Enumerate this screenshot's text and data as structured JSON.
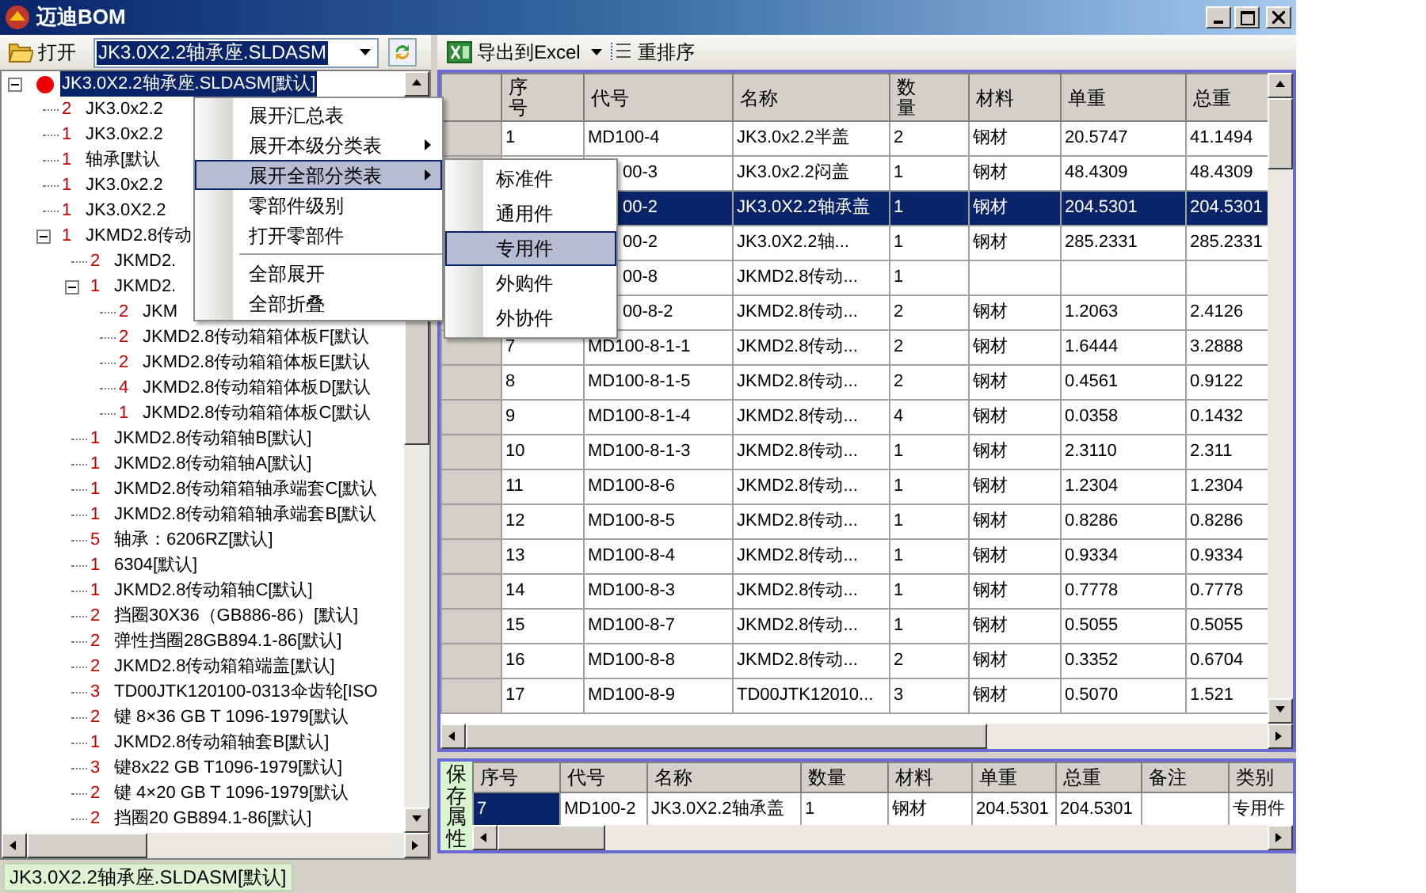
{
  "window": {
    "title": "迈迪BOM"
  },
  "left_toolbar": {
    "open_button": "打开",
    "file_combo": {
      "value": "JK3.0X2.2轴承座.SLDASM"
    }
  },
  "tree": {
    "items": [
      {
        "label": "JK3.0X2.2轴承座.SLDASM[默认]",
        "selected": true,
        "expanded": true,
        "children": [
          {
            "qty": "2",
            "label": "JK3.0x2.2",
            "selected": false
          },
          {
            "qty": "1",
            "label": "JK3.0x2.2",
            "selected": false
          },
          {
            "qty": "1",
            "label": "轴承[默认",
            "selected": false
          },
          {
            "qty": "1",
            "label": "JK3.0x2.2",
            "selected": false
          },
          {
            "qty": "1",
            "label": "JK3.0X2.2",
            "selected": false
          },
          {
            "qty": "1",
            "label": "JKMD2.8传动",
            "selected": false,
            "expanded": true,
            "children": [
              {
                "qty": "2",
                "label": "JKMD2.",
                "selected": false
              },
              {
                "qty": "1",
                "label": "JKMD2.",
                "selected": false,
                "expanded": true,
                "children": [
                  {
                    "qty": "2",
                    "label": "JKM",
                    "selected": false
                  },
                  {
                    "qty": "2",
                    "label": "JKMD2.8传动箱箱体板F[默认",
                    "selected": false
                  },
                  {
                    "qty": "2",
                    "label": "JKMD2.8传动箱箱体板E[默认",
                    "selected": false
                  },
                  {
                    "qty": "4",
                    "label": "JKMD2.8传动箱箱体板D[默认",
                    "selected": false
                  },
                  {
                    "qty": "1",
                    "label": "JKMD2.8传动箱箱体板C[默认",
                    "selected": false
                  }
                ]
              },
              {
                "qty": "1",
                "label": "JKMD2.8传动箱轴B[默认]",
                "selected": false
              },
              {
                "qty": "1",
                "label": "JKMD2.8传动箱轴A[默认]",
                "selected": false
              },
              {
                "qty": "1",
                "label": "JKMD2.8传动箱箱轴承端套C[默认",
                "selected": false
              },
              {
                "qty": "1",
                "label": "JKMD2.8传动箱箱轴承端套B[默认",
                "selected": false
              },
              {
                "qty": "5",
                "label": "轴承：6206RZ[默认]",
                "selected": false
              },
              {
                "qty": "1",
                "label": "6304[默认]",
                "selected": false
              },
              {
                "qty": "1",
                "label": "JKMD2.8传动箱轴C[默认]",
                "selected": false
              },
              {
                "qty": "2",
                "label": "挡圈30X36（GB886-86）[默认]",
                "selected": false
              },
              {
                "qty": "2",
                "label": "弹性挡圈28GB894.1-86[默认]",
                "selected": false
              },
              {
                "qty": "2",
                "label": "JKMD2.8传动箱箱端盖[默认]",
                "selected": false
              },
              {
                "qty": "3",
                "label": "TD00JTK120100-0313伞齿轮[ISO",
                "selected": false
              },
              {
                "qty": "2",
                "label": "键 8×36 GB T 1096-1979[默认",
                "selected": false
              },
              {
                "qty": "1",
                "label": "JKMD2.8传动箱轴套B[默认]",
                "selected": false
              },
              {
                "qty": "3",
                "label": "键8x22 GB T1096-1979[默认]",
                "selected": false
              },
              {
                "qty": "2",
                "label": "键 4×20 GB T 1096-1979[默认",
                "selected": false
              },
              {
                "qty": "2",
                "label": "挡圈20 GB894.1-86[默认]",
                "selected": false
              }
            ]
          }
        ]
      }
    ]
  },
  "context_menu": {
    "items": [
      {
        "kind": "item",
        "label": "展开汇总表",
        "submenu": false,
        "selected": false
      },
      {
        "kind": "item",
        "label": "展开本级分类表",
        "submenu": true,
        "selected": false
      },
      {
        "kind": "item",
        "label": "展开全部分类表",
        "submenu": true,
        "selected": true
      },
      {
        "kind": "item",
        "label": "零部件级别",
        "submenu": false,
        "selected": false
      },
      {
        "kind": "item",
        "label": "打开零部件",
        "submenu": false,
        "selected": false
      },
      {
        "kind": "separator"
      },
      {
        "kind": "item",
        "label": "全部展开",
        "submenu": false,
        "selected": false
      },
      {
        "kind": "item",
        "label": "全部折叠",
        "submenu": false,
        "selected": false
      }
    ]
  },
  "submenu": {
    "items": [
      {
        "label": "标准件",
        "selected": false
      },
      {
        "label": "通用件",
        "selected": false
      },
      {
        "label": "专用件",
        "selected": true
      },
      {
        "label": "外购件",
        "selected": false
      },
      {
        "label": "外协件",
        "selected": false
      }
    ]
  },
  "right_toolbar": {
    "export_button": "导出到Excel",
    "reorder_button": "重排序"
  },
  "grid": {
    "columns": [
      {
        "label": "序号",
        "kind": "stacked"
      },
      {
        "label": "代号",
        "kind": "plain"
      },
      {
        "label": "名称",
        "kind": "plain"
      },
      {
        "label": "数量",
        "kind": "stacked"
      },
      {
        "label": "材料",
        "kind": "plain"
      },
      {
        "label": "单重",
        "kind": "plain"
      },
      {
        "label": "总重",
        "kind": "plain"
      }
    ],
    "rows": [
      {
        "no": "1",
        "code": "MD100-4",
        "name": "JK3.0x2.2半盖",
        "qty": "2",
        "material": "钢材",
        "unit_weight": "20.5747",
        "total_weight": "41.1494",
        "selected": false
      },
      {
        "code": "00-3",
        "name": "JK3.0x2.2闷盖",
        "qty": "1",
        "material": "钢材",
        "unit_weight": "48.4309",
        "total_weight": "48.4309",
        "selected": false
      },
      {
        "code": "00-2",
        "name": "JK3.0X2.2轴承盖",
        "qty": "1",
        "material": "钢材",
        "unit_weight": "204.5301",
        "total_weight": "204.5301",
        "selected": true
      },
      {
        "code": "00-2",
        "name": "JK3.0X2.2轴...",
        "qty": "1",
        "material": "钢材",
        "unit_weight": "285.2331",
        "total_weight": "285.2331",
        "selected": false
      },
      {
        "code": "00-8",
        "name": "JKMD2.8传动...",
        "qty": "1",
        "selected": false
      },
      {
        "code": "00-8-2",
        "name": "JKMD2.8传动...",
        "qty": "2",
        "material": "钢材",
        "unit_weight": "1.2063",
        "total_weight": "2.4126",
        "selected": false
      },
      {
        "no": "7",
        "code": "MD100-8-1-1",
        "name": "JKMD2.8传动...",
        "qty": "2",
        "material": "钢材",
        "unit_weight": "1.6444",
        "total_weight": "3.2888",
        "selected": false
      },
      {
        "no": "8",
        "code": "MD100-8-1-5",
        "name": "JKMD2.8传动...",
        "qty": "2",
        "material": "钢材",
        "unit_weight": "0.4561",
        "total_weight": "0.9122",
        "selected": false
      },
      {
        "no": "9",
        "code": "MD100-8-1-4",
        "name": "JKMD2.8传动...",
        "qty": "4",
        "material": "钢材",
        "unit_weight": "0.0358",
        "total_weight": "0.1432",
        "selected": false
      },
      {
        "no": "10",
        "code": "MD100-8-1-3",
        "name": "JKMD2.8传动...",
        "qty": "1",
        "material": "钢材",
        "unit_weight": "2.3110",
        "total_weight": "2.311",
        "selected": false
      },
      {
        "no": "11",
        "code": "MD100-8-6",
        "name": "JKMD2.8传动...",
        "qty": "1",
        "material": "钢材",
        "unit_weight": "1.2304",
        "total_weight": "1.2304",
        "selected": false
      },
      {
        "no": "12",
        "code": "MD100-8-5",
        "name": "JKMD2.8传动...",
        "qty": "1",
        "material": "钢材",
        "unit_weight": "0.8286",
        "total_weight": "0.8286",
        "selected": false
      },
      {
        "no": "13",
        "code": "MD100-8-4",
        "name": "JKMD2.8传动...",
        "qty": "1",
        "material": "钢材",
        "unit_weight": "0.9334",
        "total_weight": "0.9334",
        "selected": false
      },
      {
        "no": "14",
        "code": "MD100-8-3",
        "name": "JKMD2.8传动...",
        "qty": "1",
        "material": "钢材",
        "unit_weight": "0.7778",
        "total_weight": "0.7778",
        "selected": false
      },
      {
        "no": "15",
        "code": "MD100-8-7",
        "name": "JKMD2.8传动...",
        "qty": "1",
        "material": "钢材",
        "unit_weight": "0.5055",
        "total_weight": "0.5055",
        "selected": false
      },
      {
        "no": "16",
        "code": "MD100-8-8",
        "name": "JKMD2.8传动...",
        "qty": "2",
        "material": "钢材",
        "unit_weight": "0.3352",
        "total_weight": "0.6704",
        "selected": false
      },
      {
        "no": "17",
        "code": "MD100-8-9",
        "name": "TD00JTK12010...",
        "qty": "3",
        "material": "钢材",
        "unit_weight": "0.5070",
        "total_weight": "1.521",
        "selected": false
      }
    ]
  },
  "property_panel": {
    "save_button": "保存属性",
    "columns": [
      "序号",
      "代号",
      "名称",
      "数量",
      "材料",
      "单重",
      "总重",
      "备注",
      "类别"
    ],
    "cells": [
      {
        "text": "7",
        "selected": true
      },
      {
        "text": "MD100-2",
        "selected": false
      },
      {
        "text": "JK3.0X2.2轴承盖",
        "selected": false
      },
      {
        "text": "1",
        "selected": false
      },
      {
        "text": "钢材",
        "selected": false
      },
      {
        "text": "204.5301",
        "selected": false
      },
      {
        "text": "204.5301",
        "selected": false
      },
      {
        "selected": false
      },
      {
        "text": "专用件",
        "selected": false
      }
    ]
  },
  "status_bar": {
    "text": "JK3.0X2.2轴承座.SLDASM[默认]"
  }
}
